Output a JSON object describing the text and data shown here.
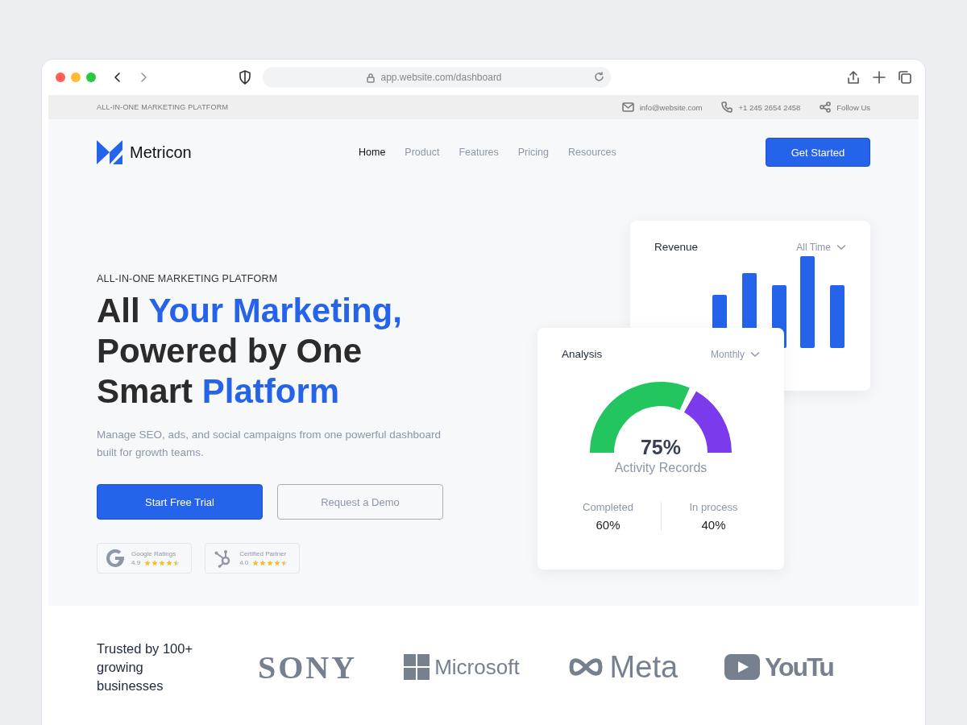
{
  "browser": {
    "url": "app.website.com/dashboard"
  },
  "topbar": {
    "tagline": "ALL-IN-ONE MARKETING PLATFORM",
    "contacts": [
      {
        "kind": "email",
        "text": "info@website.com"
      },
      {
        "kind": "phone",
        "text": "+1 245 2654 2458"
      },
      {
        "kind": "share",
        "text": "Follow Us"
      }
    ]
  },
  "nav": {
    "brand": "Metricon",
    "links": [
      {
        "label": "Home",
        "selected": true
      },
      {
        "label": "Product",
        "selected": false
      },
      {
        "label": "Features",
        "selected": false
      },
      {
        "label": "Pricing",
        "selected": false
      },
      {
        "label": "Resources",
        "selected": false
      }
    ],
    "cta": "Get Started"
  },
  "hero": {
    "eyebrow": "ALL-IN-ONE MARKETING PLATFORM",
    "headline": [
      [
        {
          "text": "All ",
          "highlight": false
        },
        {
          "text": "Your Marketing,",
          "highlight": true
        }
      ],
      [
        {
          "text": "Powered by One",
          "highlight": false
        }
      ],
      [
        {
          "text": "Smart ",
          "highlight": false
        },
        {
          "text": "Platform",
          "highlight": true
        }
      ]
    ],
    "subtitle": "Manage SEO, ads, and social campaigns from one powerful dashboard built for growth teams.",
    "buttons": [
      {
        "label": "Start Free Trial",
        "kind": "primary"
      },
      {
        "label": "Request a Demo",
        "kind": "outline"
      }
    ],
    "badges": [
      {
        "kind": "google",
        "title": "Google Ratings",
        "score": "4.9",
        "stars": 4.5
      },
      {
        "kind": "hub",
        "title": "Certified Partner",
        "score": "4.0",
        "stars": 4.5
      }
    ]
  },
  "revenue_card": {
    "title": "Revenue",
    "period": "All Time"
  },
  "analysis_card": {
    "title": "Analysis",
    "period": "Monthly",
    "gauge": {
      "level": 0.65,
      "value": "75%",
      "label": "Activity Records"
    },
    "stats": [
      {
        "label": "Completed",
        "value": "60%"
      },
      {
        "label": "In process",
        "value": "40%"
      }
    ]
  },
  "trusted": {
    "text": "Trusted by 100+ growing businesses",
    "logos": [
      {
        "kind": "sony",
        "text": "SONY"
      },
      {
        "kind": "microsoft",
        "text": "Microsoft"
      },
      {
        "kind": "meta",
        "text": "Meta"
      },
      {
        "kind": "youtube",
        "text": "YouTu"
      }
    ]
  }
}
